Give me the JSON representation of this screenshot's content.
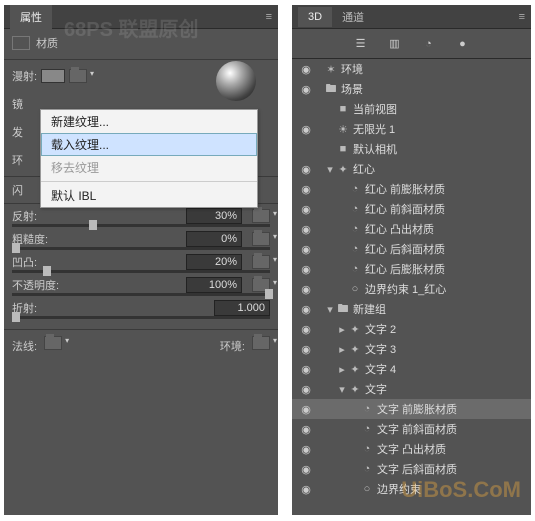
{
  "left": {
    "tab": "属性",
    "section_label": "材质",
    "labels": {
      "diffuse": "漫射:",
      "specular": "镜",
      "emit": "发",
      "env": "环",
      "shine": "闪",
      "reflect": "反射:",
      "roughness": "粗糙度:",
      "bump": "凹凸:",
      "opacity": "不透明度:",
      "refract": "折射:",
      "normals": "法线:",
      "env_bottom": "环境:"
    },
    "values": {
      "reflect": "30%",
      "roughness": "0%",
      "bump": "20%",
      "opacity": "100%",
      "refract": "1.000"
    },
    "context_menu": {
      "new": "新建纹理...",
      "load": "载入纹理...",
      "remove": "移去纹理",
      "default_ibl": "默认 IBL"
    }
  },
  "right": {
    "tabs": {
      "a": "3D",
      "b": "通道"
    },
    "items": {
      "env": "环境",
      "scene": "场景",
      "current_view": "当前视图",
      "inf_light": "无限光 1",
      "default_cam": "默认相机",
      "hongxin": "红心",
      "hx_front": "红心 前膨胀材质",
      "hx_bevel": "红心 前斜面材质",
      "hx_extrude": "红心 凸出材质",
      "hx_back_bevel": "红心 后斜面材质",
      "hx_back": "红心 后膨胀材质",
      "hx_bound": "边界约束 1_红心",
      "new_group": "新建组",
      "text2": "文字 2",
      "text3": "文字 3",
      "text4": "文字 4",
      "text": "文字",
      "t_front": "文字 前膨胀材质",
      "t_bevel": "文字 前斜面材质",
      "t_extrude": "文字 凸出材质",
      "t_back_bevel": "文字 后斜面材质",
      "t_bound": "边界约束"
    }
  },
  "watermarks": {
    "top": "68PS 联盟原创",
    "bottom": "UiBoS.CoM"
  }
}
